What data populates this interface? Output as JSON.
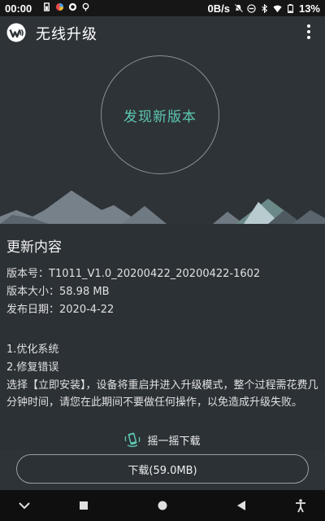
{
  "status_bar": {
    "time": "00:00",
    "net_speed": "0B/s",
    "battery": "13%"
  },
  "app_bar": {
    "title": "无线升级"
  },
  "hero": {
    "status_text": "发现新版本"
  },
  "details": {
    "section_title": "更新内容",
    "version_line": "版本号：T1011_V1.0_20200422_20200422-1602",
    "size_line": "版本大小：58.98 MB",
    "date_line": "发布日期：2020-4-22",
    "notes": [
      "1.优化系统",
      "2.修复错误"
    ],
    "warning": "选择【立即安装】，设备将重启并进入升级模式，整个过程需花费几分钟时间，请您在此期间不要做任何操作，以免造成升级失败。"
  },
  "actions": {
    "shake_label": "摇一摇下载",
    "download_label": "下载(59.0MB)"
  },
  "colors": {
    "accent": "#5cc8b0",
    "background": "#2e3338"
  },
  "icons": {
    "app": "wifi-logo-icon",
    "overflow": "more-vert-icon",
    "shake": "shake-phone-icon",
    "nav": [
      "nav-down-icon",
      "nav-square-icon",
      "nav-circle-icon",
      "nav-back-icon",
      "accessibility-icon"
    ]
  }
}
